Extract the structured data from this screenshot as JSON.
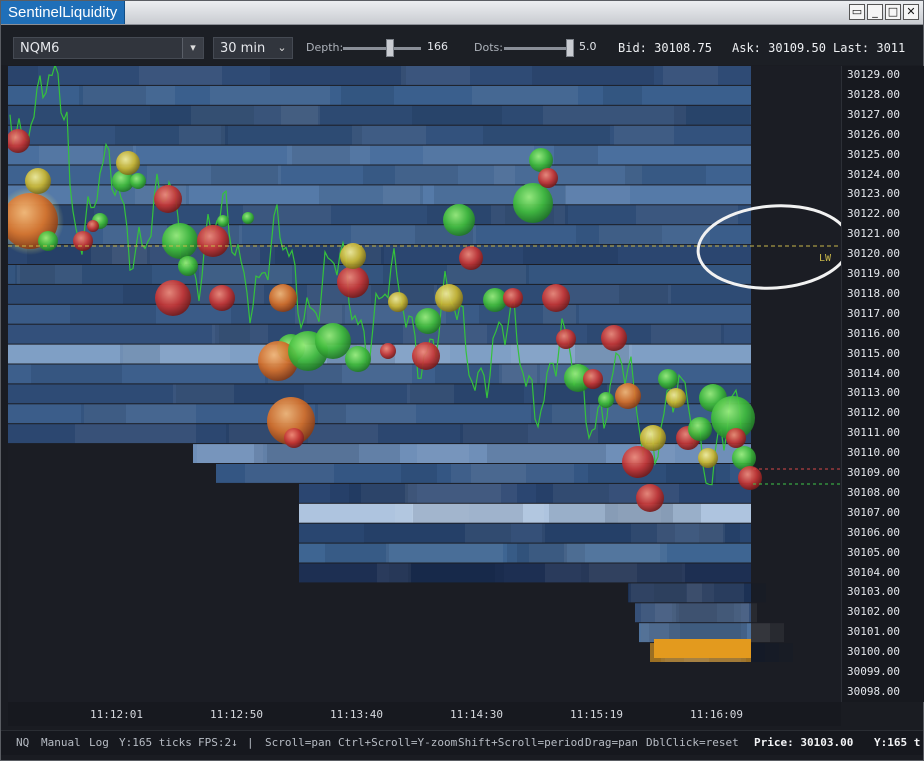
{
  "window": {
    "title": "SentinelLiquidity"
  },
  "toolbar": {
    "symbol": "NQM6",
    "period": "30 min",
    "depth_label": "Depth:",
    "depth_value": "166",
    "dots_label": "Dots:",
    "dots_value": "5.0",
    "bid": "Bid: 30108.75",
    "ask": "Ask: 30109.50",
    "last": "Last: 3011"
  },
  "chart": {
    "marker_label": "LW",
    "colors": {
      "buy": "#44c64a",
      "sell": "#c93a3a",
      "neutral": "#c8b93a",
      "marker": "#c9b84a",
      "volume": "#e39a1e"
    }
  },
  "yaxis": {
    "labels": [
      "30129.00",
      "30128.00",
      "30127.00",
      "30126.00",
      "30125.00",
      "30124.00",
      "30123.00",
      "30122.00",
      "30121.00",
      "30120.00",
      "30119.00",
      "30118.00",
      "30117.00",
      "30116.00",
      "30115.00",
      "30114.00",
      "30113.00",
      "30112.00",
      "30111.00",
      "30110.00",
      "30109.00",
      "30108.00",
      "30107.00",
      "30106.00",
      "30105.00",
      "30104.00",
      "30103.00",
      "30102.00",
      "30101.00",
      "30100.00",
      "30099.00",
      "30098.00"
    ]
  },
  "xaxis": {
    "labels": [
      "11:12:01",
      "11:12:50",
      "11:13:40",
      "11:14:30",
      "11:15:19",
      "11:16:09"
    ]
  },
  "status": {
    "symbol": "NQ",
    "mode": "Manual",
    "scale": "Log",
    "y_ticks": "Y:165 ticks",
    "fps": "FPS:2↓",
    "sep": "|",
    "hint_scroll": "Scroll=pan",
    "hint_ctrl": "Ctrl+Scroll=Y-zoom",
    "hint_shift": "Shift+Scroll=period",
    "hint_drag": "Drag=pan",
    "hint_dbl": "DblClick=reset",
    "price": "Price: 30103.00",
    "y_right": "Y:165 t"
  }
}
